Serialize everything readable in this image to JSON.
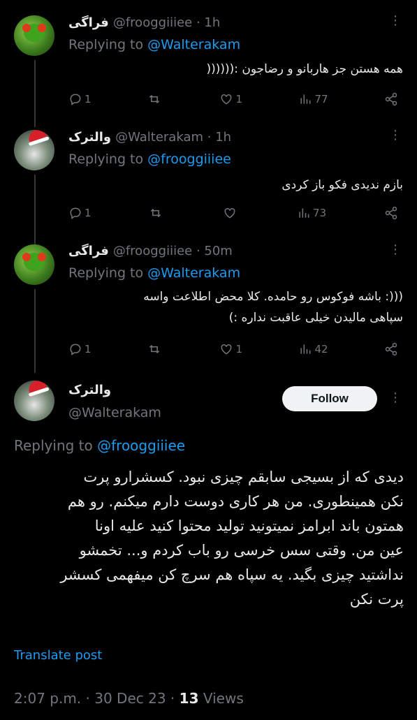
{
  "tweets": [
    {
      "name": "فراگی",
      "handle": "@frooggiiiee",
      "time": "· 1h",
      "replying_prefix": "Replying to",
      "replying_to": "@Walterakam",
      "text": "همه هستن جز هاربانو و رضاجون :((((((",
      "replies": "1",
      "reposts": "",
      "likes": "1",
      "views": "77",
      "avatar": "frog"
    },
    {
      "name": "والترک",
      "handle": "@Walterakam",
      "time": "· 1h",
      "replying_prefix": "Replying to",
      "replying_to": "@frooggiiiee",
      "text": "بازم ندیدی فکو باز کردی",
      "replies": "1",
      "reposts": "",
      "likes": "",
      "views": "73",
      "avatar": "walter"
    },
    {
      "name": "فراگی",
      "handle": "@frooggiiiee",
      "time": "· 50m",
      "replying_prefix": "Replying to",
      "replying_to": "@Walterakam",
      "text_lines": [
        "(((: باشه فوکوس رو حامده. کلا محض اطلاعت واسه",
        "سپاهی مالیدن خیلی عاقبت نداره :)"
      ],
      "replies": "1",
      "reposts": "",
      "likes": "1",
      "views": "42",
      "avatar": "frog"
    }
  ],
  "main": {
    "name": "والترک",
    "handle": "@Walterakam",
    "follow_label": "Follow",
    "replying_prefix": "Replying to",
    "replying_to": "@frooggiiiee",
    "lines": [
      "دیدی که از بسیجی سابقم چیزی نبود. کسشرارو پرت",
      "نکن همینطوری. من هر کاری دوست دارم میکنم. رو هم",
      "همتون باند ابرامز نمیتونید تولید محتوا کنید علیه اونا",
      "عین من. وقتی سس خرسی رو باب کردم و... تخمشو",
      "نداشتید چیزی بگید. یه سپاه هم سرچ کن میفهمی کسشر",
      "پرت نکن"
    ],
    "translate": "Translate post",
    "time": "2:07 p.m.",
    "date": "30 Dec 23",
    "views_count": "13",
    "views_label": "Views"
  }
}
